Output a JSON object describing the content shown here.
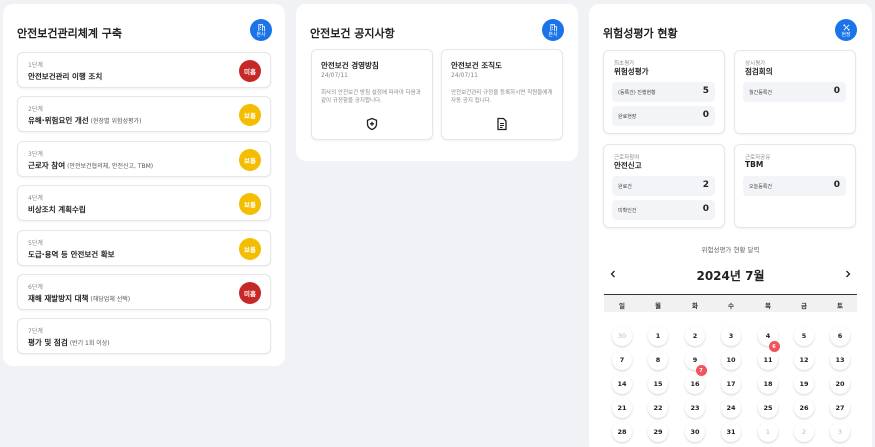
{
  "mgmt": {
    "title": "안전보건관리체계 구축",
    "button_label": "본사",
    "steps": [
      {
        "num": "1단계",
        "name": "안전보건관리 이행 조치",
        "sub": "",
        "status": "미흡"
      },
      {
        "num": "2단계",
        "name": "유해·위험요인 개선",
        "sub": "(현장별 위험성평가)",
        "status": "보통"
      },
      {
        "num": "3단계",
        "name": "근로자 참여",
        "sub": "(안전보건협의체, 안전신고, TBM)",
        "status": "보통"
      },
      {
        "num": "4단계",
        "name": "비상조치 계획수립",
        "sub": "",
        "status": "보통"
      },
      {
        "num": "5단계",
        "name": "도급·용역 등 안전보건 확보",
        "sub": "",
        "status": "보통"
      },
      {
        "num": "6단계",
        "name": "재해 재발방지 대책",
        "sub": "(해당업체 선택)",
        "status": "미흡"
      },
      {
        "num": "7단계",
        "name": "평가 및 점검",
        "sub": "(반기 1회 이상)",
        "status": ""
      }
    ]
  },
  "notice": {
    "title": "안전보건 공지사항",
    "button_label": "본사",
    "items": [
      {
        "title": "안전보건 경영방침",
        "date": "24/07/11",
        "text": "회사의 안전보건 방침 설정에 따라야 다음과 같이 규정함을 공지합니다.",
        "icon": "shield-plus-icon"
      },
      {
        "title": "안전보건 조직도",
        "date": "24/07/11",
        "text": "안전보건관리 규정을 등록하시면 직원들에게 자동 공지 됩니다.",
        "icon": "document-icon"
      }
    ]
  },
  "risk": {
    "title": "위험성평가 현황",
    "button_label": "현장",
    "boxes": [
      {
        "sub": "최초평가",
        "title": "위험성평가",
        "stats": [
          {
            "label": "(등록건) 진행현황",
            "value": "5"
          },
          {
            "label": "완료현장",
            "value": "0"
          }
        ]
      },
      {
        "sub": "상시평가",
        "title": "점검회의",
        "stats": [
          {
            "label": "월간등록건",
            "value": "0"
          }
        ]
      },
      {
        "sub": "근로자참여",
        "title": "안전신고",
        "stats": [
          {
            "label": "완료건",
            "value": "2"
          },
          {
            "label": "미확인건",
            "value": "0"
          }
        ]
      },
      {
        "sub": "근로자공유",
        "title": "TBM",
        "stats": [
          {
            "label": "오늘등록건",
            "value": "0"
          }
        ]
      }
    ],
    "calendar": {
      "caption": "위험성평가 현황 달력",
      "month": "2024년 7월",
      "weekdays": [
        "일",
        "월",
        "화",
        "수",
        "목",
        "금",
        "토"
      ],
      "rows": [
        [
          "30",
          "1",
          "2",
          "3",
          "4",
          "5",
          "6"
        ],
        [
          "7",
          "8",
          "9",
          "10",
          "11",
          "12",
          "13"
        ],
        [
          "14",
          "15",
          "16",
          "17",
          "18",
          "19",
          "20"
        ],
        [
          "21",
          "22",
          "23",
          "24",
          "25",
          "26",
          "27"
        ],
        [
          "28",
          "29",
          "30",
          "31",
          "1",
          "2",
          "3"
        ]
      ],
      "events": [
        {
          "row": 1,
          "col": 4,
          "count": "6"
        },
        {
          "row": 2,
          "col": 2,
          "count": "7"
        }
      ]
    }
  },
  "colors": {
    "accent": "#1a73e8",
    "poor": "#c62828",
    "normal": "#f5bd00",
    "event": "#f2545b"
  }
}
